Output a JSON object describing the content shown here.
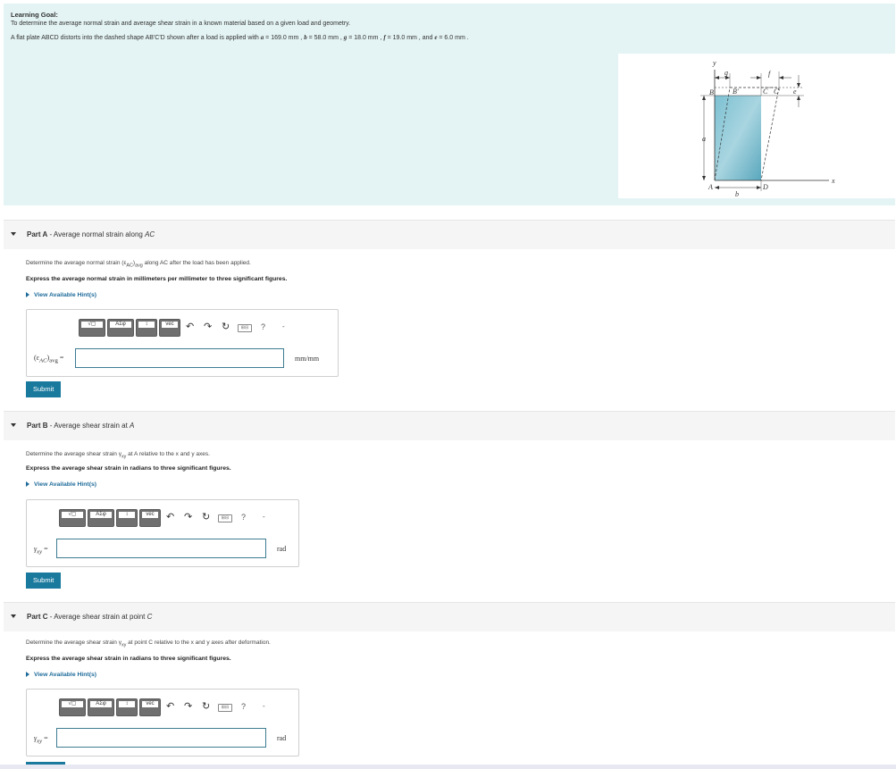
{
  "goal": {
    "title": "Learning Goal:",
    "text": "To determine the average normal strain and average shear strain in a known material based on a given load and geometry.",
    "desc_prefix": "A flat plate ABCD distorts into the dashed shape AB'C'D shown after a load is applied with",
    "a_sym": "a",
    "a_val": " = 169.0 mm ,",
    "b_sym": "b",
    "b_val": " = 58.0 mm ,",
    "g_sym": "g",
    "g_val": " = 18.0 mm ,",
    "f_sym": "f",
    "f_val": " = 19.0 mm , and",
    "e_sym": "e",
    "e_val": " = 6.0 mm ."
  },
  "figure": {
    "labels": {
      "y": "y",
      "x": "x",
      "A": "A",
      "B": "B",
      "Bp": "B'",
      "C": "C",
      "Cp": "C'",
      "D": "D",
      "a": "a",
      "b": "b",
      "g": "g",
      "f": "f",
      "e": "e"
    },
    "colors": {
      "plate": "#6fb6c9",
      "plate_light": "#a8d5e0"
    }
  },
  "toolbar": {
    "btn1": "√▢",
    "btn2": "ΑΣφ",
    "btn3": "↕",
    "btn4": "vec",
    "undo_icon": "undo-icon",
    "redo_icon": "redo-icon",
    "reset_icon": "reset-icon",
    "keyboard_label": "⊞⊟",
    "help": "?",
    "more": "-"
  },
  "partA": {
    "letter": "Part A",
    "title": " - Average normal strain along ",
    "title_var": "AC",
    "instr": "Determine the average normal strain (ε",
    "instr_sub": "AC",
    "instr_mid": ")",
    "instr_sub2": "avg",
    "instr_end": " along AC after the load has been applied.",
    "express": "Express the average normal strain in millimeters per millimeter to three significant figures.",
    "hint": "View Available Hint(s)",
    "label_main": "(ε",
    "label_sub": "AC",
    "label_close": ")",
    "label_sub2": "avg",
    "label_eq": " =",
    "input_value": "",
    "unit": "mm/mm",
    "submit": "Submit"
  },
  "partB": {
    "letter": "Part B",
    "title": " - Average shear strain at ",
    "title_var": "A",
    "instr": "Determine the average shear strain γ",
    "instr_sub": "xy",
    "instr_end": " at A relative to the x and y axes.",
    "express": "Express the average shear strain in radians to three significant figures.",
    "hint": "View Available Hint(s)",
    "label_main": "γ",
    "label_sub": "xy",
    "label_eq": " =",
    "input_value": "",
    "unit": "rad",
    "submit": "Submit"
  },
  "partC": {
    "letter": "Part C",
    "title": " - Average shear strain at point ",
    "title_var": "C",
    "instr": "Determine the average shear strain γ",
    "instr_sub": "xy",
    "instr_end": " at point C relative to the x and y axes after deformation.",
    "express": "Express the average shear strain in radians to three significant figures.",
    "hint": "View Available Hint(s)",
    "label_main": "γ",
    "label_sub": "xy",
    "label_eq": " =",
    "input_value": "",
    "unit": "rad"
  }
}
